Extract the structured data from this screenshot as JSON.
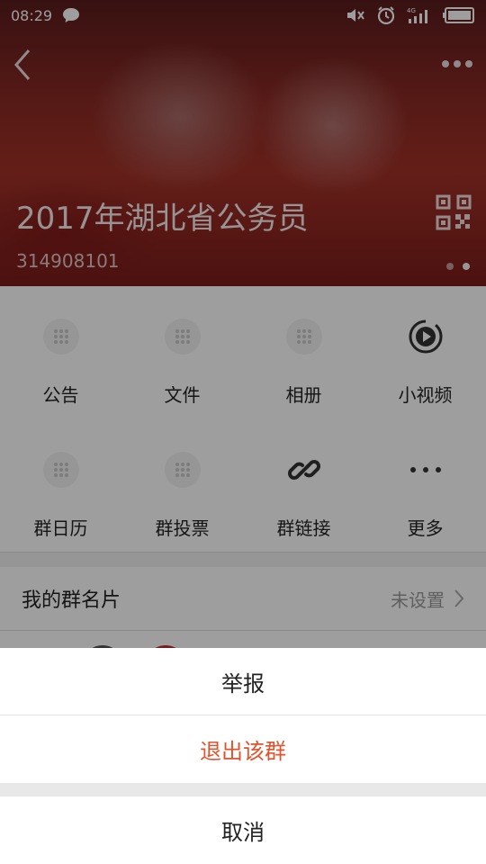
{
  "status_bar": {
    "time": "08:29",
    "network_label": "4G"
  },
  "header": {
    "group_name": "2017年湖北省公务员",
    "group_id": "314908101"
  },
  "features": [
    {
      "label": "公告",
      "icon": "dots-grid-icon"
    },
    {
      "label": "文件",
      "icon": "dots-grid-icon"
    },
    {
      "label": "相册",
      "icon": "dots-grid-icon"
    },
    {
      "label": "小视频",
      "icon": "video-play-icon"
    },
    {
      "label": "群日历",
      "icon": "dots-grid-icon"
    },
    {
      "label": "群投票",
      "icon": "dots-grid-icon"
    },
    {
      "label": "群链接",
      "icon": "link-icon"
    },
    {
      "label": "更多",
      "icon": "more-dots-icon"
    }
  ],
  "card": {
    "label": "我的群名片",
    "value": "未设置"
  },
  "action_sheet": {
    "report": "举报",
    "quit": "退出该群",
    "cancel": "取消"
  },
  "colors": {
    "quit_text": "#e2532d",
    "overlay": "rgba(0,0,0,0.38)"
  }
}
